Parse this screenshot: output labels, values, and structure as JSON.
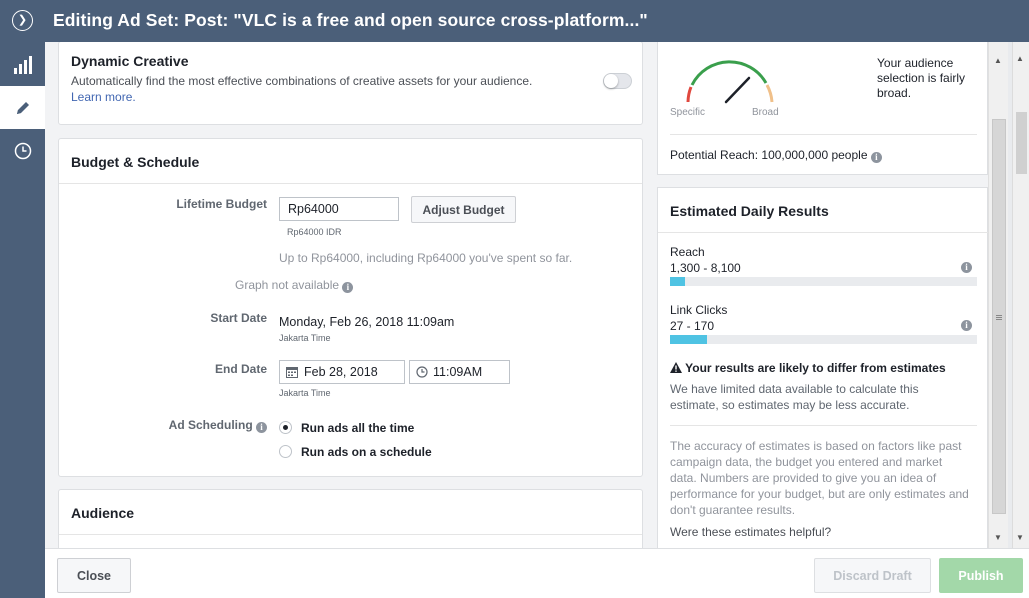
{
  "window": {
    "title": "Editing Ad Set: Post: \"VLC is a free and open source cross-platform...\""
  },
  "dynamic_creative": {
    "heading": "Dynamic Creative",
    "description": "Automatically find the most effective combinations of creative assets for your audience.",
    "learn_more": "Learn more."
  },
  "budget": {
    "heading": "Budget & Schedule",
    "lifetime_label": "Lifetime Budget",
    "lifetime_value": "Rp64000",
    "lifetime_currency": "Rp64000 IDR",
    "adjust_button": "Adjust Budget",
    "spend_note": "Up to Rp64000, including Rp64000 you've spent so far.",
    "graph_note": "Graph not available",
    "start_label": "Start Date",
    "start_value": "Monday, Feb 26, 2018 11:09am",
    "start_tz": "Jakarta Time",
    "end_label": "End Date",
    "end_date": "Feb 28, 2018",
    "end_time": "11:09AM",
    "end_tz": "Jakarta Time",
    "scheduling_label": "Ad Scheduling",
    "option_all_time": "Run ads all the time",
    "option_schedule": "Run ads on a schedule"
  },
  "audience": {
    "heading": "Audience"
  },
  "audience_definition": {
    "gauge_specific": "Specific",
    "gauge_broad": "Broad",
    "summary": [
      "Your audience",
      "selection is fairly",
      "broad."
    ],
    "potential_reach": "Potential Reach: 100,000,000 people"
  },
  "estimates": {
    "heading": "Estimated Daily Results",
    "reach_label": "Reach",
    "reach_range": "1,300 - 8,100",
    "reach_fill": 0.05,
    "clicks_label": "Link Clicks",
    "clicks_range": "27 - 170",
    "clicks_fill": 0.12,
    "warning_title": "Your results are likely to differ from estimates",
    "warning_body": [
      "We have limited data available to calculate this",
      "estimate, so estimates may be less accurate."
    ],
    "accuracy_note": [
      "The accuracy of estimates is based on factors like past",
      "campaign data, the budget you entered and market",
      "data. Numbers are provided to give you an idea of",
      "performance for your budget, but are only estimates and",
      "don't guarantee results."
    ],
    "helpful_link": "Were these estimates helpful?"
  },
  "footer": {
    "close": "Close",
    "discard": "Discard Draft",
    "publish": "Publish"
  },
  "colors": {
    "header_bg": "#4b5f79",
    "bar_fill": "#4fc3e3",
    "publish_bg": "#a3d8a9",
    "gauge_green": "#3a9f4c",
    "gauge_red": "#e0483e"
  }
}
